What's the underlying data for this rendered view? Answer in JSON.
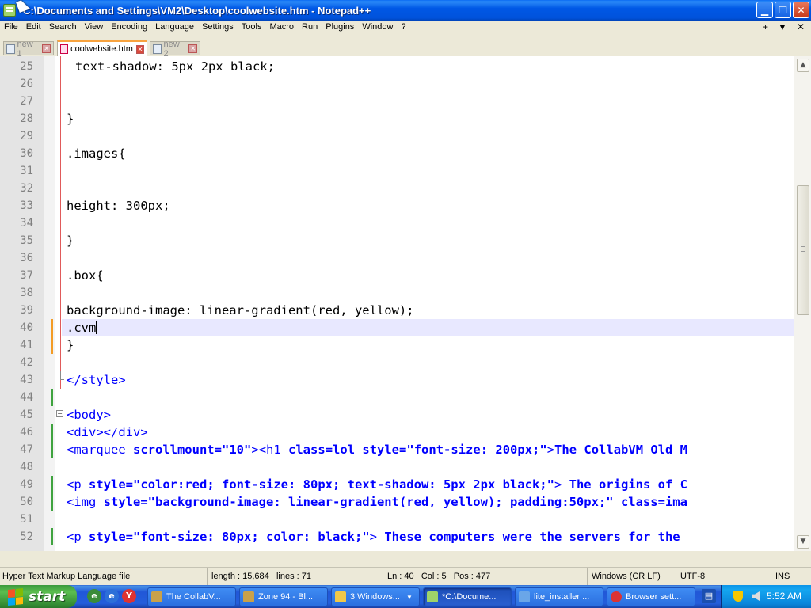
{
  "window": {
    "title": "*C:\\Documents and Settings\\VM2\\Desktop\\coolwebsite.htm - Notepad++",
    "buttons": {
      "minimize": "▁",
      "maximize": "❐",
      "close": "✕"
    }
  },
  "menu": {
    "items": [
      "File",
      "Edit",
      "Search",
      "View",
      "Encoding",
      "Language",
      "Settings",
      "Tools",
      "Macro",
      "Run",
      "Plugins",
      "Window",
      "?"
    ],
    "right": [
      "+",
      "▼",
      "✕"
    ]
  },
  "tabs": [
    {
      "label": "new 1",
      "active": false
    },
    {
      "label": "coolwebsite.htm",
      "active": true
    },
    {
      "label": "new 2",
      "active": false
    }
  ],
  "editor": {
    "current_line": 40,
    "lines": [
      {
        "n": "25",
        "text": "text-shadow: 5px 2px black;"
      },
      {
        "n": "26",
        "text": ""
      },
      {
        "n": "27",
        "text": ""
      },
      {
        "n": "28",
        "text": "}"
      },
      {
        "n": "29",
        "text": ""
      },
      {
        "n": "30",
        "text": ".images{"
      },
      {
        "n": "31",
        "text": ""
      },
      {
        "n": "32",
        "text": ""
      },
      {
        "n": "33",
        "text": "height: 300px;"
      },
      {
        "n": "34",
        "text": ""
      },
      {
        "n": "35",
        "text": "}"
      },
      {
        "n": "36",
        "text": ""
      },
      {
        "n": "37",
        "text": ".box{"
      },
      {
        "n": "38",
        "text": ""
      },
      {
        "n": "39",
        "text": "background-image: linear-gradient(red, yellow);"
      },
      {
        "n": "40",
        "text": ".cvm"
      },
      {
        "n": "41",
        "text": "}"
      },
      {
        "n": "42",
        "text": ""
      },
      {
        "n": "43",
        "text": "</style>"
      },
      {
        "n": "44",
        "text": ""
      },
      {
        "n": "45",
        "text": "<body>"
      },
      {
        "n": "46",
        "text": "<div></div>"
      },
      {
        "n": "47",
        "text": "<marquee scrollmount=\"10\"><h1 class=lol style=\"font-size: 200px;\">The CollabVM Old M"
      },
      {
        "n": "48",
        "text": ""
      },
      {
        "n": "49",
        "text": "<p style=\"color:red; font-size: 80px; text-shadow: 5px 2px black;\"> The origins of C"
      },
      {
        "n": "50",
        "text": "<img style=\"background-image: linear-gradient(red, yellow); padding:50px;\" class=ima"
      },
      {
        "n": "51",
        "text": ""
      },
      {
        "n": "52",
        "text": "<p style=\"font-size: 80px; color: black;\"> These computers were the servers for the"
      }
    ]
  },
  "status": {
    "file_type": "Hyper Text Markup Language file",
    "length": "length : 15,684",
    "lines": "lines : 71",
    "ln": "Ln : 40",
    "col": "Col : 5",
    "pos": "Pos : 477",
    "eol": "Windows (CR LF)",
    "encoding": "UTF-8",
    "mode": "INS"
  },
  "taskbar": {
    "start_label": "start",
    "items": [
      {
        "label": "The CollabV...",
        "active": false
      },
      {
        "label": "Zone 94 - Bl...",
        "active": false
      },
      {
        "label": "3 Windows...",
        "active": false
      },
      {
        "label": "*C:\\Docume...",
        "active": true
      },
      {
        "label": "lite_installer ...",
        "active": false
      },
      {
        "label": "Browser sett...",
        "active": false
      }
    ],
    "clock": "5:52 AM"
  },
  "colors": {
    "tag": "#0000FF",
    "attribute": "#FF0000",
    "string": "#8000FF",
    "caret_line": "#E8E8FF",
    "title_bar": "#0054E3"
  }
}
